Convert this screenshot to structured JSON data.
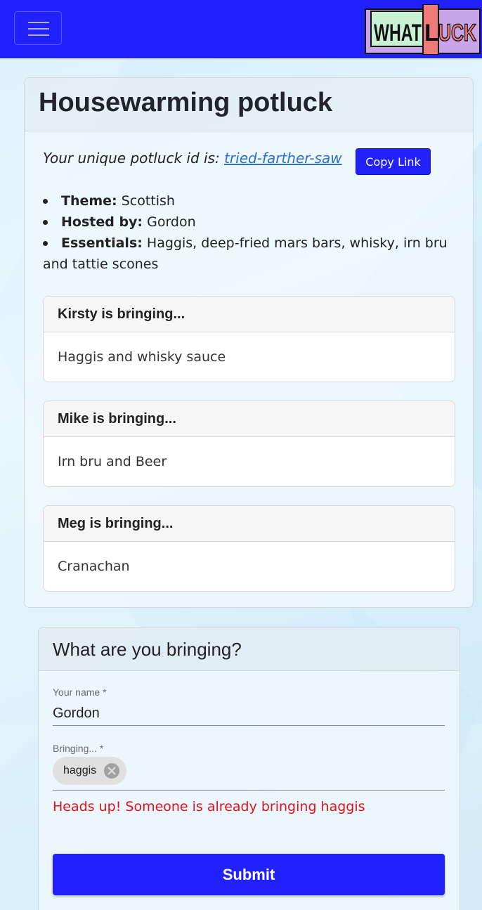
{
  "app": {
    "logo_text": "WHATLUCK"
  },
  "potluck": {
    "title": "Housewarming potluck",
    "id_prefix": "Your unique potluck id is:",
    "id_value": "tried-farther-saw",
    "copy_label": "Copy Link",
    "details": [
      {
        "label": "Theme:",
        "value": "Scottish"
      },
      {
        "label": "Hosted by:",
        "value": "Gordon"
      },
      {
        "label": "Essentials:",
        "value": "Haggis, deep-fried mars bars, whisky, irn bru and tattie scones"
      }
    ],
    "contributions": [
      {
        "header": "Kirsty is bringing...",
        "item": "Haggis and whisky sauce"
      },
      {
        "header": "Mike is bringing...",
        "item": "Irn bru and Beer"
      },
      {
        "header": "Meg is bringing...",
        "item": "Cranachan"
      }
    ]
  },
  "form": {
    "title": "What are you bringing?",
    "name_label": "Your name *",
    "name_value": "Gordon",
    "bringing_label": "Bringing... *",
    "chips": [
      "haggis"
    ],
    "warning": "Heads up! Someone is already bringing haggis",
    "submit_label": "Submit"
  },
  "colors": {
    "primary": "#2121fd",
    "warning": "#e0121b",
    "link": "#2e6ecf"
  }
}
